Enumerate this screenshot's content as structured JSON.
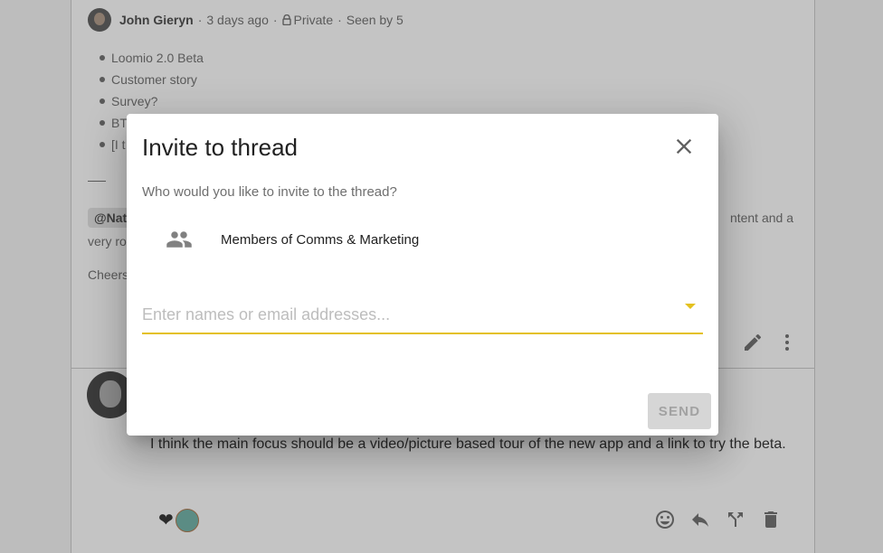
{
  "thread": {
    "author": "John Gieryn",
    "time": "3 days ago",
    "privacy": "Private",
    "seen": "Seen by 5",
    "separator": "·",
    "bullets": [
      "Loomio 2.0 Beta",
      "Customer story",
      "Survey?",
      "BT",
      "[I t"
    ],
    "mention_chip": "@Nat",
    "mention_tail": "ntent and a",
    "mention_line2": "very ro",
    "cheers": "Cheers"
  },
  "comment": {
    "text": "I think the main focus should be a video/picture based tour of the new app and a link to try the beta.",
    "reaction_emoji": "❤"
  },
  "modal": {
    "title": "Invite to thread",
    "prompt": "Who would you like to invite to the thread?",
    "group_label": "Members of Comms & Marketing",
    "input_placeholder": "Enter names or email addresses...",
    "input_value": "",
    "send_label": "SEND"
  },
  "icons": {
    "close": "close-icon",
    "group": "people-icon",
    "dropdown": "dropdown-arrow-icon",
    "edit": "pencil-icon",
    "more": "more-vertical-icon",
    "emoji": "emoji-icon",
    "reply": "reply-icon",
    "fork": "fork-icon",
    "delete": "trash-icon",
    "lock": "lock-icon"
  },
  "colors": {
    "accent": "#e4c11f",
    "send_disabled_bg": "#d6d6d6",
    "send_disabled_text": "#a2a2a2"
  }
}
